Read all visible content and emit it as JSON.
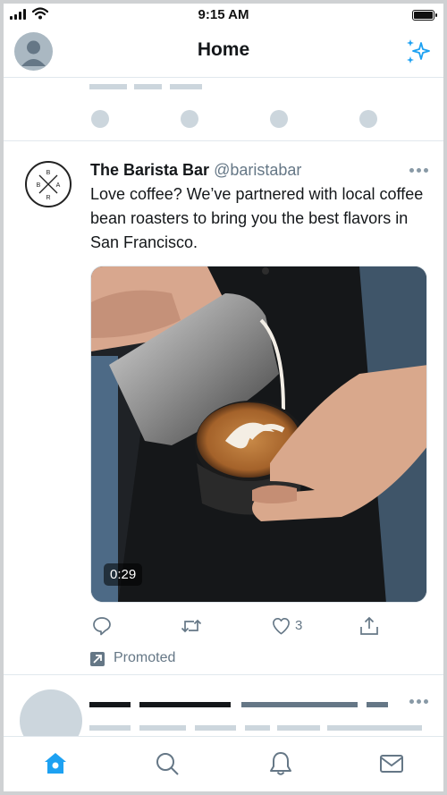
{
  "status_bar": {
    "time": "9:15 AM"
  },
  "header": {
    "title": "Home"
  },
  "tweet": {
    "display_name": "The Barista Bar",
    "handle": "@baristabar",
    "text": "Love coffee? We’ve partnered with local coffee bean roasters to bring you the best flavors in San Francisco.",
    "video_duration": "0:29",
    "like_count": "3",
    "promoted_label": "Promoted"
  },
  "colors": {
    "accent": "#1da1f2",
    "text_primary": "#14171a",
    "text_secondary": "#657786",
    "skeleton": "#ccd6dd",
    "divider": "#e1e8ed"
  },
  "icons": {
    "header": [
      "avatar",
      "sparkle-icon"
    ],
    "actions": [
      "reply-icon",
      "retweet-icon",
      "like-icon",
      "share-icon"
    ],
    "tabs": [
      "home-icon",
      "search-icon",
      "notifications-icon",
      "messages-icon"
    ],
    "promoted": "promoted-arrow-icon",
    "brand_logo": "barista-bar-logo"
  }
}
